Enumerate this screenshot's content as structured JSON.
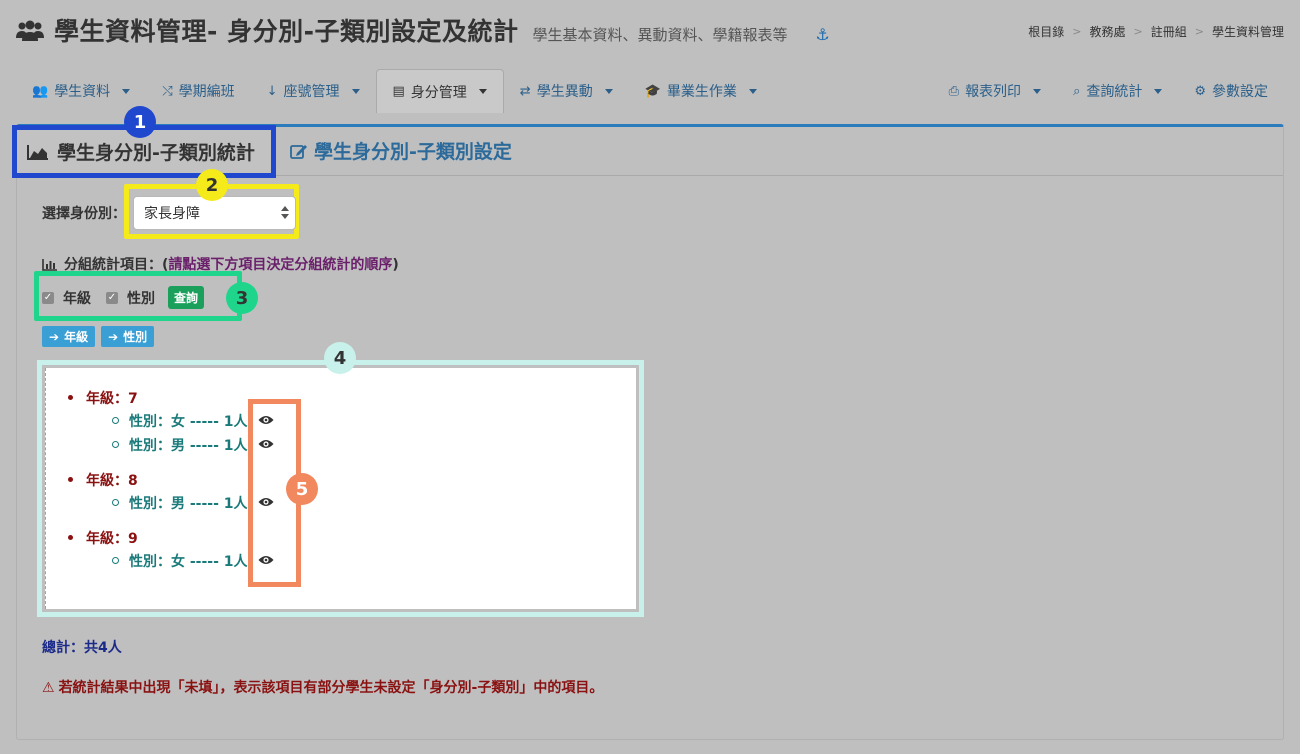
{
  "header": {
    "title": "學生資料管理- 身分別-子類別設定及統計",
    "subtitle": "學生基本資料、異動資料、學籍報表等"
  },
  "breadcrumb": [
    "根目錄",
    "教務處",
    "註冊組",
    "學生資料管理"
  ],
  "nav": {
    "left": [
      {
        "label": "學生資料",
        "icon": "users-icon",
        "dropdown": true
      },
      {
        "label": "學期編班",
        "icon": "shuffle-icon",
        "dropdown": false
      },
      {
        "label": "座號管理",
        "icon": "sort-numeric-icon",
        "dropdown": true
      },
      {
        "label": "身分管理",
        "icon": "id-card-icon",
        "dropdown": true,
        "active": true
      },
      {
        "label": "學生異動",
        "icon": "exchange-icon",
        "dropdown": true
      },
      {
        "label": "畢業生作業",
        "icon": "graduation-cap-icon",
        "dropdown": true
      }
    ],
    "right": [
      {
        "label": "報表列印",
        "icon": "print-icon",
        "dropdown": true
      },
      {
        "label": "查詢統計",
        "icon": "search-icon",
        "dropdown": true
      },
      {
        "label": "參數設定",
        "icon": "gear-icon",
        "dropdown": false
      }
    ]
  },
  "tabs": {
    "stat": "學生身分別-子類別統計",
    "setting": "學生身分別-子類別設定"
  },
  "badges": [
    "1",
    "2",
    "3",
    "4",
    "5"
  ],
  "filter": {
    "select_label": "選擇身份別：",
    "selected": "家長身障",
    "group_label": "分組統計項目：(",
    "group_hint": "請點選下方項目決定分組統計的順序",
    "group_close": ")",
    "checks": [
      {
        "label": "年級",
        "checked": true
      },
      {
        "label": "性別",
        "checked": true
      }
    ],
    "query_button": "查詢",
    "order_chips": [
      "年級",
      "性別"
    ]
  },
  "results": [
    {
      "grade": "年級：7",
      "items": [
        "性別：女 ----- 1人",
        "性別：男 ----- 1人"
      ]
    },
    {
      "grade": "年級：8",
      "items": [
        "性別：男 ----- 1人"
      ]
    },
    {
      "grade": "年級：9",
      "items": [
        "性別：女 ----- 1人"
      ]
    }
  ],
  "total": "總計：共4人",
  "warning": "若統計結果中出現「未填」，表示該項目有部分學生未設定「身分別-子類別」中的項目。",
  "colors": {
    "accent": "#2b7bbd",
    "badge1": "#1f48cf",
    "badge2": "#f5ea1a",
    "badge3": "#1fd58b",
    "badge4": "#c7f1ea",
    "badge5": "#f2885d"
  }
}
